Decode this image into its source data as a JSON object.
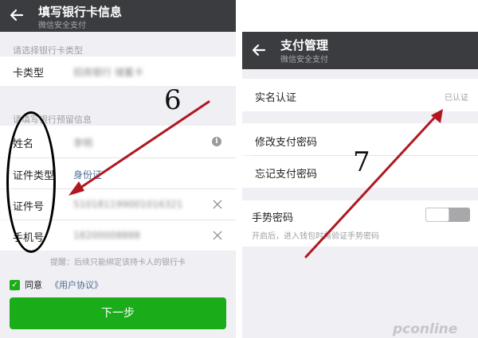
{
  "left": {
    "title": "填写银行卡信息",
    "subtitle": "微信安全支付",
    "card_type_section": "请选择银行卡类型",
    "card_type_label": "卡类型",
    "card_type_value": "招商银行 储蓄卡",
    "reserved_section": "请填写银行预留信息",
    "name_label": "姓名",
    "name_value": "李明",
    "id_type_label": "证件类型",
    "id_type_value": "身份证",
    "id_number_label": "证件号",
    "id_number_value": "510181199001016321",
    "phone_label": "手机号",
    "phone_value": "18200008888",
    "tip": "提醒：后续只能绑定该持卡人的银行卡",
    "agree_label": "同意",
    "agreement_link": "《用户协议》",
    "next_button": "下一步"
  },
  "right": {
    "title": "支付管理",
    "subtitle": "微信安全支付",
    "real_name_label": "实名认证",
    "real_name_status": "已认证",
    "change_pwd_label": "修改支付密码",
    "forgot_pwd_label": "忘记支付密码",
    "gesture_label": "手势密码",
    "gesture_hint": "开启后，进入钱包时需验证手势密码",
    "gesture_enabled": false
  },
  "annotations": {
    "step_left": "6",
    "step_right": "7"
  },
  "watermark": "pconline",
  "colors": {
    "header_bg": "#3b3c40",
    "wechat_green": "#1aad19",
    "page_bg": "#efeff4",
    "arrow_red": "#b0171f",
    "link_blue": "#4f6a96"
  },
  "icons": [
    "back-arrow-icon",
    "info-icon",
    "clear-icon",
    "check-icon"
  ]
}
